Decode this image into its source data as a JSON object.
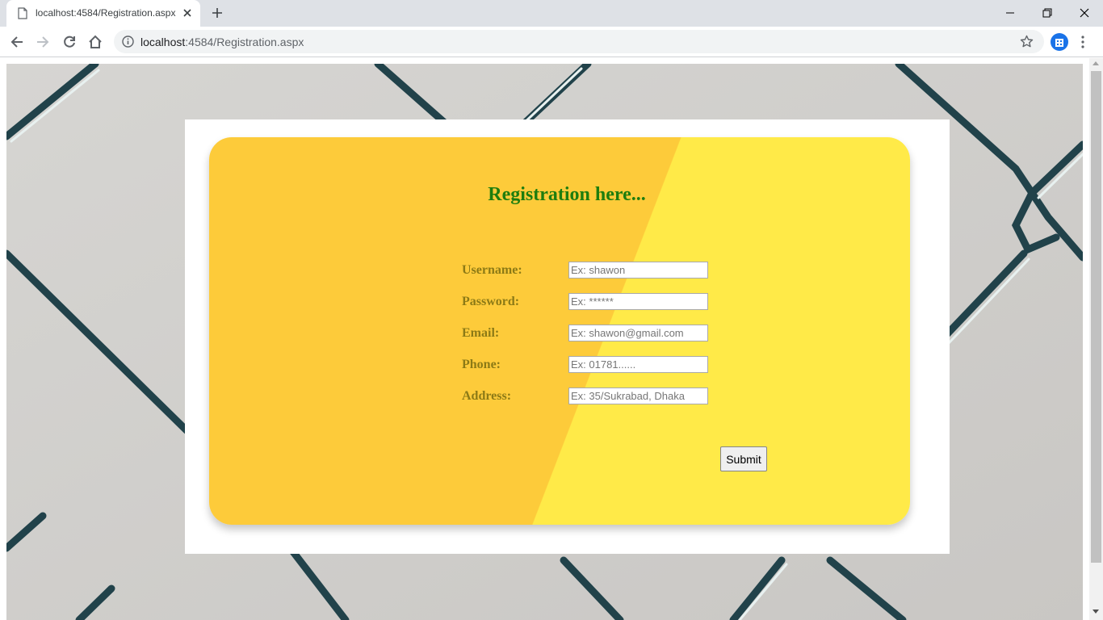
{
  "browser": {
    "tab_title": "localhost:4584/Registration.aspx",
    "url_host": "localhost",
    "url_rest": ":4584/Registration.aspx"
  },
  "form": {
    "title": "Registration here...",
    "fields": [
      {
        "label": "Username:",
        "placeholder": "Ex: shawon"
      },
      {
        "label": "Password:",
        "placeholder": "Ex: ******"
      },
      {
        "label": "Email:",
        "placeholder": "Ex: shawon@gmail.com"
      },
      {
        "label": "Phone:",
        "placeholder": "Ex: 01781......"
      },
      {
        "label": "Address:",
        "placeholder": "Ex: 35/Sukrabad, Dhaka"
      }
    ],
    "submit_label": "Submit"
  },
  "colors": {
    "card_left": "#fdcb3a",
    "card_right": "#ffea48",
    "title": "#1e7d0e",
    "label": "#8c7a16"
  }
}
